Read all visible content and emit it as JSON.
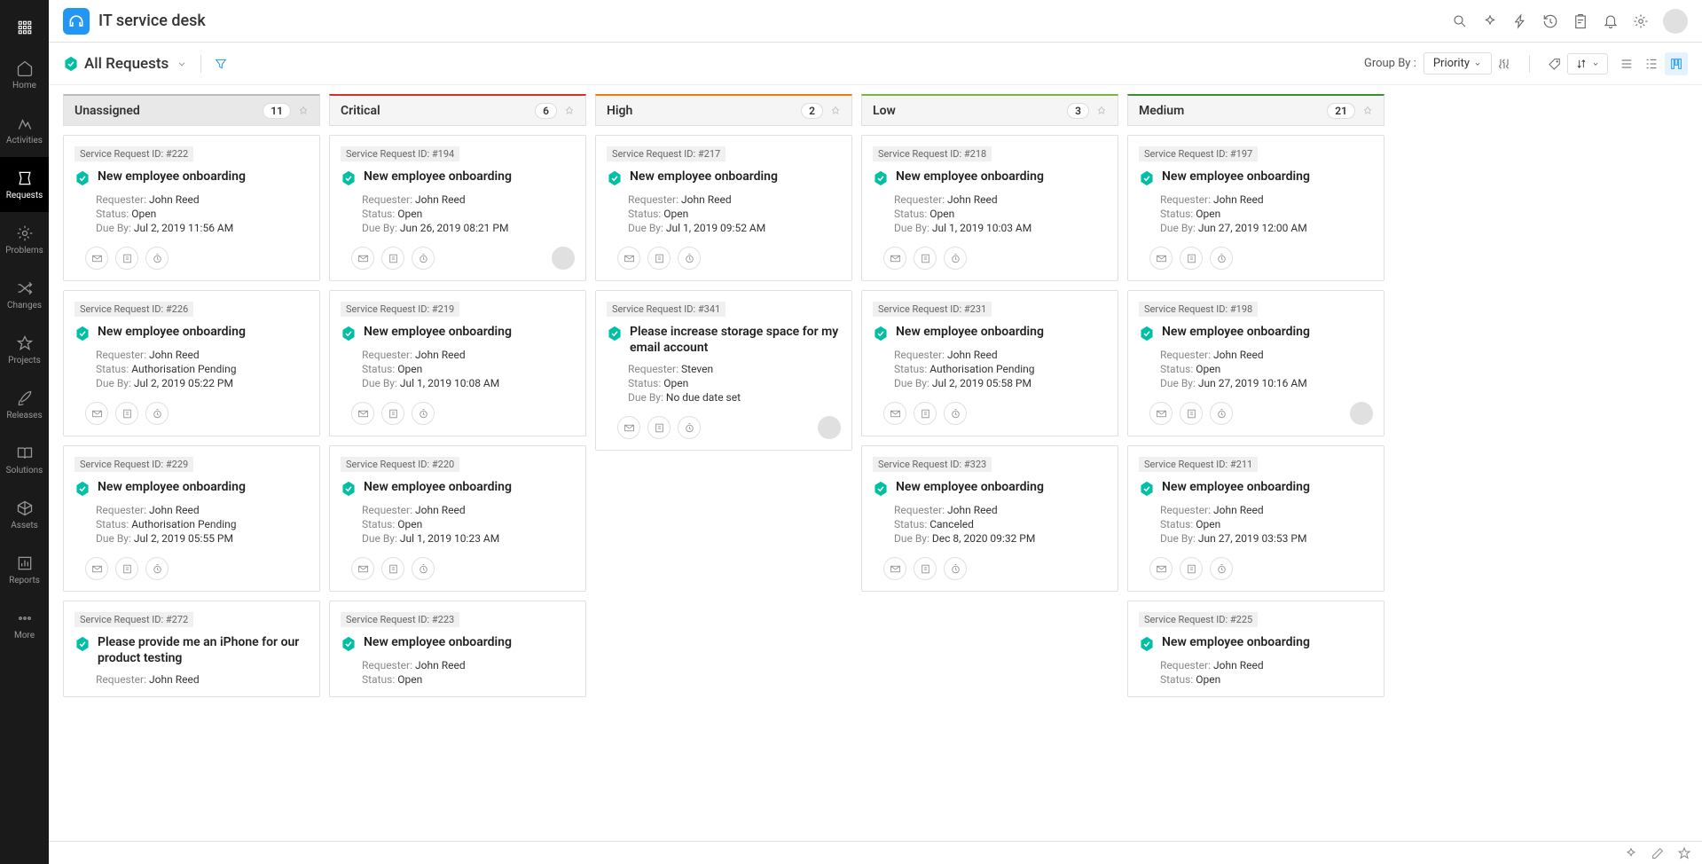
{
  "app": {
    "title": "IT service desk"
  },
  "sidebar": {
    "items": [
      {
        "label": "Home"
      },
      {
        "label": "Activities"
      },
      {
        "label": "Requests"
      },
      {
        "label": "Problems"
      },
      {
        "label": "Changes"
      },
      {
        "label": "Projects"
      },
      {
        "label": "Releases"
      },
      {
        "label": "Solutions"
      },
      {
        "label": "Assets"
      },
      {
        "label": "Reports"
      },
      {
        "label": "More"
      }
    ]
  },
  "toolbar": {
    "view_title": "All Requests",
    "groupby_label": "Group By :",
    "groupby_value": "Priority"
  },
  "labels": {
    "id_prefix": "Service Request ID: #",
    "requester": "Requester:",
    "status": "Status:",
    "dueby": "Due By:"
  },
  "columns": [
    {
      "name": "Unassigned",
      "count": "11",
      "cls": "unassigned-h",
      "cards": [
        {
          "id": "222",
          "title": "New employee onboarding",
          "requester": "John Reed",
          "status": "Open",
          "due": "Jul 2, 2019 11:56 AM",
          "avatar": false
        },
        {
          "id": "226",
          "title": "New employee onboarding",
          "requester": "John Reed",
          "status": "Authorisation Pending",
          "due": "Jul 2, 2019 05:22 PM",
          "avatar": false
        },
        {
          "id": "229",
          "title": "New employee onboarding",
          "requester": "John Reed",
          "status": "Authorisation Pending",
          "due": "Jul 2, 2019 05:55 PM",
          "avatar": false
        },
        {
          "id": "272",
          "title": "Please provide me an iPhone for our product testing",
          "requester": "John Reed",
          "status": "",
          "due": "",
          "avatar": false,
          "partial": true
        }
      ]
    },
    {
      "name": "Critical",
      "count": "6",
      "cls": "critical-h",
      "cards": [
        {
          "id": "194",
          "title": "New employee onboarding",
          "requester": "John Reed",
          "status": "Open",
          "due": "Jun 26, 2019 08:21 PM",
          "avatar": true
        },
        {
          "id": "219",
          "title": "New employee onboarding",
          "requester": "John Reed",
          "status": "Open",
          "due": "Jul 1, 2019 10:08 AM",
          "avatar": false
        },
        {
          "id": "220",
          "title": "New employee onboarding",
          "requester": "John Reed",
          "status": "Open",
          "due": "Jul 1, 2019 10:23 AM",
          "avatar": false
        },
        {
          "id": "223",
          "title": "New employee onboarding",
          "requester": "John Reed",
          "status": "Open",
          "due": "",
          "avatar": false,
          "partial": true
        }
      ]
    },
    {
      "name": "High",
      "count": "2",
      "cls": "high-h",
      "cards": [
        {
          "id": "217",
          "title": "New employee onboarding",
          "requester": "John Reed",
          "status": "Open",
          "due": "Jul 1, 2019 09:52 AM",
          "avatar": false
        },
        {
          "id": "341",
          "title": "Please increase storage space for my email account",
          "requester": "Steven",
          "status": "Open",
          "due": "No due date set",
          "avatar": true
        }
      ]
    },
    {
      "name": "Low",
      "count": "3",
      "cls": "low-h",
      "cards": [
        {
          "id": "218",
          "title": "New employee onboarding",
          "requester": "John Reed",
          "status": "Open",
          "due": "Jul 1, 2019 10:03 AM",
          "avatar": false
        },
        {
          "id": "231",
          "title": "New employee onboarding",
          "requester": "John Reed",
          "status": "Authorisation Pending",
          "due": "Jul 2, 2019 05:58 PM",
          "avatar": false
        },
        {
          "id": "323",
          "title": "New employee onboarding",
          "requester": "John Reed",
          "status": "Canceled",
          "due": "Dec 8, 2020 09:32 PM",
          "avatar": false
        }
      ]
    },
    {
      "name": "Medium",
      "count": "21",
      "cls": "medium-h",
      "cards": [
        {
          "id": "197",
          "title": "New employee onboarding",
          "requester": "John Reed",
          "status": "Open",
          "due": "Jun 27, 2019 12:00 AM",
          "avatar": false
        },
        {
          "id": "198",
          "title": "New employee onboarding",
          "requester": "John Reed",
          "status": "Open",
          "due": "Jun 27, 2019 10:16 AM",
          "avatar": true
        },
        {
          "id": "211",
          "title": "New employee onboarding",
          "requester": "John Reed",
          "status": "Open",
          "due": "Jun 27, 2019 03:53 PM",
          "avatar": false
        },
        {
          "id": "225",
          "title": "New employee onboarding",
          "requester": "John Reed",
          "status": "Open",
          "due": "",
          "avatar": false,
          "partial": true
        }
      ]
    }
  ]
}
